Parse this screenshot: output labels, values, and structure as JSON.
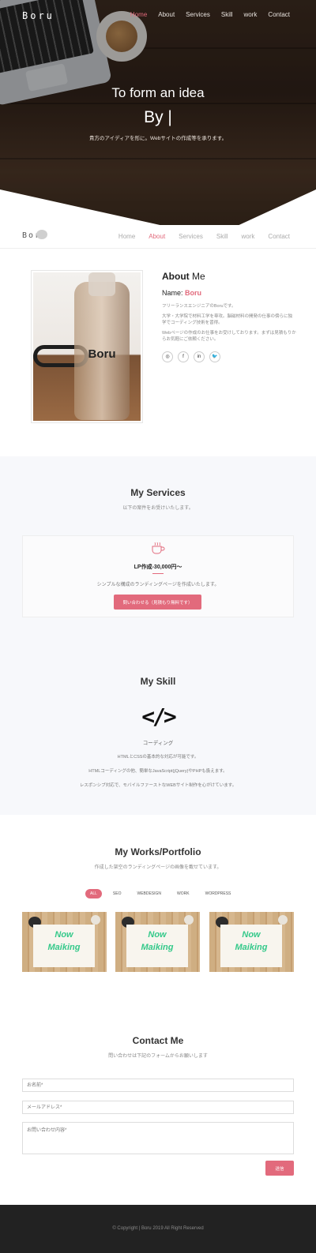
{
  "hero": {
    "brand": "Boru",
    "nav": [
      "Home",
      "About",
      "Services",
      "Skill",
      "work",
      "Contact"
    ],
    "active_nav": "Home",
    "headline": "To form an idea",
    "subheadline": "By |",
    "tagline": "貴方のアイディアを形に。Webサイトの作成等を承ります。"
  },
  "sticky_nav": {
    "brand": "Boru",
    "nav": [
      "Home",
      "About",
      "Services",
      "Skill",
      "work",
      "Contact"
    ],
    "active_nav": "About"
  },
  "about": {
    "title_bold": "About",
    "title_rest": " Me",
    "name_label": "Name: ",
    "name_value": "Boru",
    "bottle_label": "Boru",
    "paragraphs": [
      "フリーランスエンジニアのBoruです。",
      "大学・大学院で材料工学を専攻。脳磁材料の開発の仕事の傍らに独学でコーディング技術を習得。",
      "Webページの作成のお仕事をお受けしております。まずは見積もりからお気軽にご依頼ください。"
    ],
    "socials": [
      {
        "icon": "instagram-icon",
        "glyph": "◎"
      },
      {
        "icon": "facebook-icon",
        "glyph": "f"
      },
      {
        "icon": "linkedin-icon",
        "glyph": "in"
      },
      {
        "icon": "twitter-icon",
        "glyph": "🐦"
      }
    ]
  },
  "services": {
    "title_prefix": "My ",
    "title_bold": "Services",
    "subtitle": "以下の案件をお受けいたします。",
    "card": {
      "icon": "coffee-cup-icon",
      "title": "LP作成-30,000円〜",
      "description": "シンプルな構成のランディングページを作成いたします。",
      "button": "問い合わせる（見積もり無料です）"
    }
  },
  "skill": {
    "title_prefix": "My ",
    "title_bold": "Skill",
    "icon": "code-icon",
    "icon_glyph": "</>",
    "name": "コーディング",
    "lines": [
      "HTMLとCSSの基本的な対応が可能です。",
      "HTMLコーディングの他、簡単なJavaScript(jQuery)やPHPも扱えます。",
      "レスポンシブ対応で、モバイルファーストなWEBサイト制作を心がけています。"
    ]
  },
  "portfolio": {
    "title_prefix": "My ",
    "title_bold": "Works/Portfolio",
    "subtitle": "作成した架空のランディングページの画像を載せています。",
    "filters": [
      "ALL",
      "SEO",
      "WEBDESIGN",
      "WORK",
      "WORDPRESS"
    ],
    "active_filter": "ALL",
    "items": [
      {
        "line1": "Now",
        "line2": "Maiking"
      },
      {
        "line1": "Now",
        "line2": "Maiking"
      },
      {
        "line1": "Now",
        "line2": "Maiking"
      }
    ]
  },
  "contact": {
    "title_bold": "Contact",
    "title_rest": " Me",
    "subtitle": "問い合わせは下記のフォームからお願いします",
    "name_placeholder": "お名前*",
    "email_placeholder": "メールアドレス*",
    "message_placeholder": "お問い合わせ内容*",
    "submit": "送信"
  },
  "footer": {
    "copyright": "© Copyright | Boru 2019 All Right Reserved"
  },
  "colors": {
    "accent": "#e26a7c",
    "footer_bg": "#222222",
    "section_bg": "#f7f8fb"
  }
}
